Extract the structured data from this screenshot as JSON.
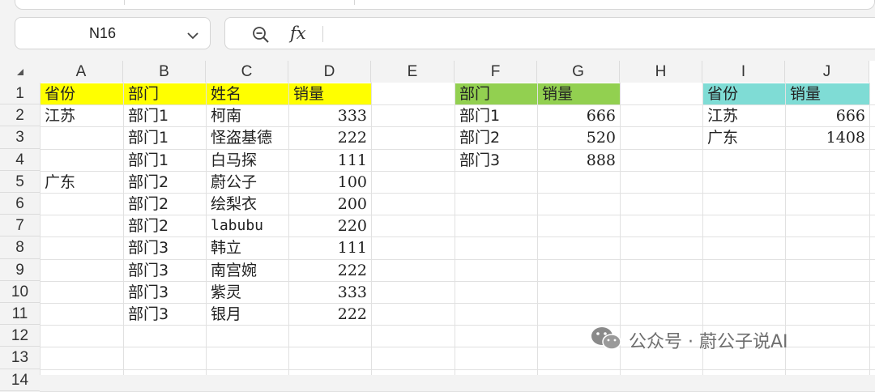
{
  "name_box": {
    "ref": "N16"
  },
  "formula_bar": {
    "fx_label": "fx",
    "value": ""
  },
  "columns": [
    "A",
    "B",
    "C",
    "D",
    "E",
    "F",
    "G",
    "H",
    "I",
    "J"
  ],
  "rows": [
    "1",
    "2",
    "3",
    "4",
    "5",
    "6",
    "7",
    "8",
    "9",
    "10",
    "11",
    "12",
    "13",
    "14"
  ],
  "header_colors": {
    "yellow": "#ffff00",
    "green": "#92d050",
    "teal": "#7fdcd5"
  },
  "table_detail": {
    "headers": [
      "省份",
      "部门",
      "姓名",
      "销量"
    ],
    "rows": [
      [
        "江苏",
        "部门1",
        "柯南",
        "333"
      ],
      [
        "",
        "部门1",
        "怪盗基德",
        "222"
      ],
      [
        "",
        "部门1",
        "白马探",
        "111"
      ],
      [
        "广东",
        "部门2",
        "蔚公子",
        "100"
      ],
      [
        "",
        "部门2",
        "绘梨衣",
        "200"
      ],
      [
        "",
        "部门2",
        "labubu",
        "220"
      ],
      [
        "",
        "部门3",
        "韩立",
        "111"
      ],
      [
        "",
        "部门3",
        "南宫婉",
        "222"
      ],
      [
        "",
        "部门3",
        "紫灵",
        "333"
      ],
      [
        "",
        "部门3",
        "银月",
        "222"
      ]
    ]
  },
  "table_dept": {
    "headers": [
      "部门",
      "销量"
    ],
    "rows": [
      [
        "部门1",
        "666"
      ],
      [
        "部门2",
        "520"
      ],
      [
        "部门3",
        "888"
      ]
    ]
  },
  "table_province": {
    "headers": [
      "省份",
      "销量"
    ],
    "rows": [
      [
        "江苏",
        "666"
      ],
      [
        "广东",
        "1408"
      ]
    ]
  },
  "watermark": {
    "text": "公众号 · 蔚公子说AI",
    "icon": "wechat-icon"
  }
}
